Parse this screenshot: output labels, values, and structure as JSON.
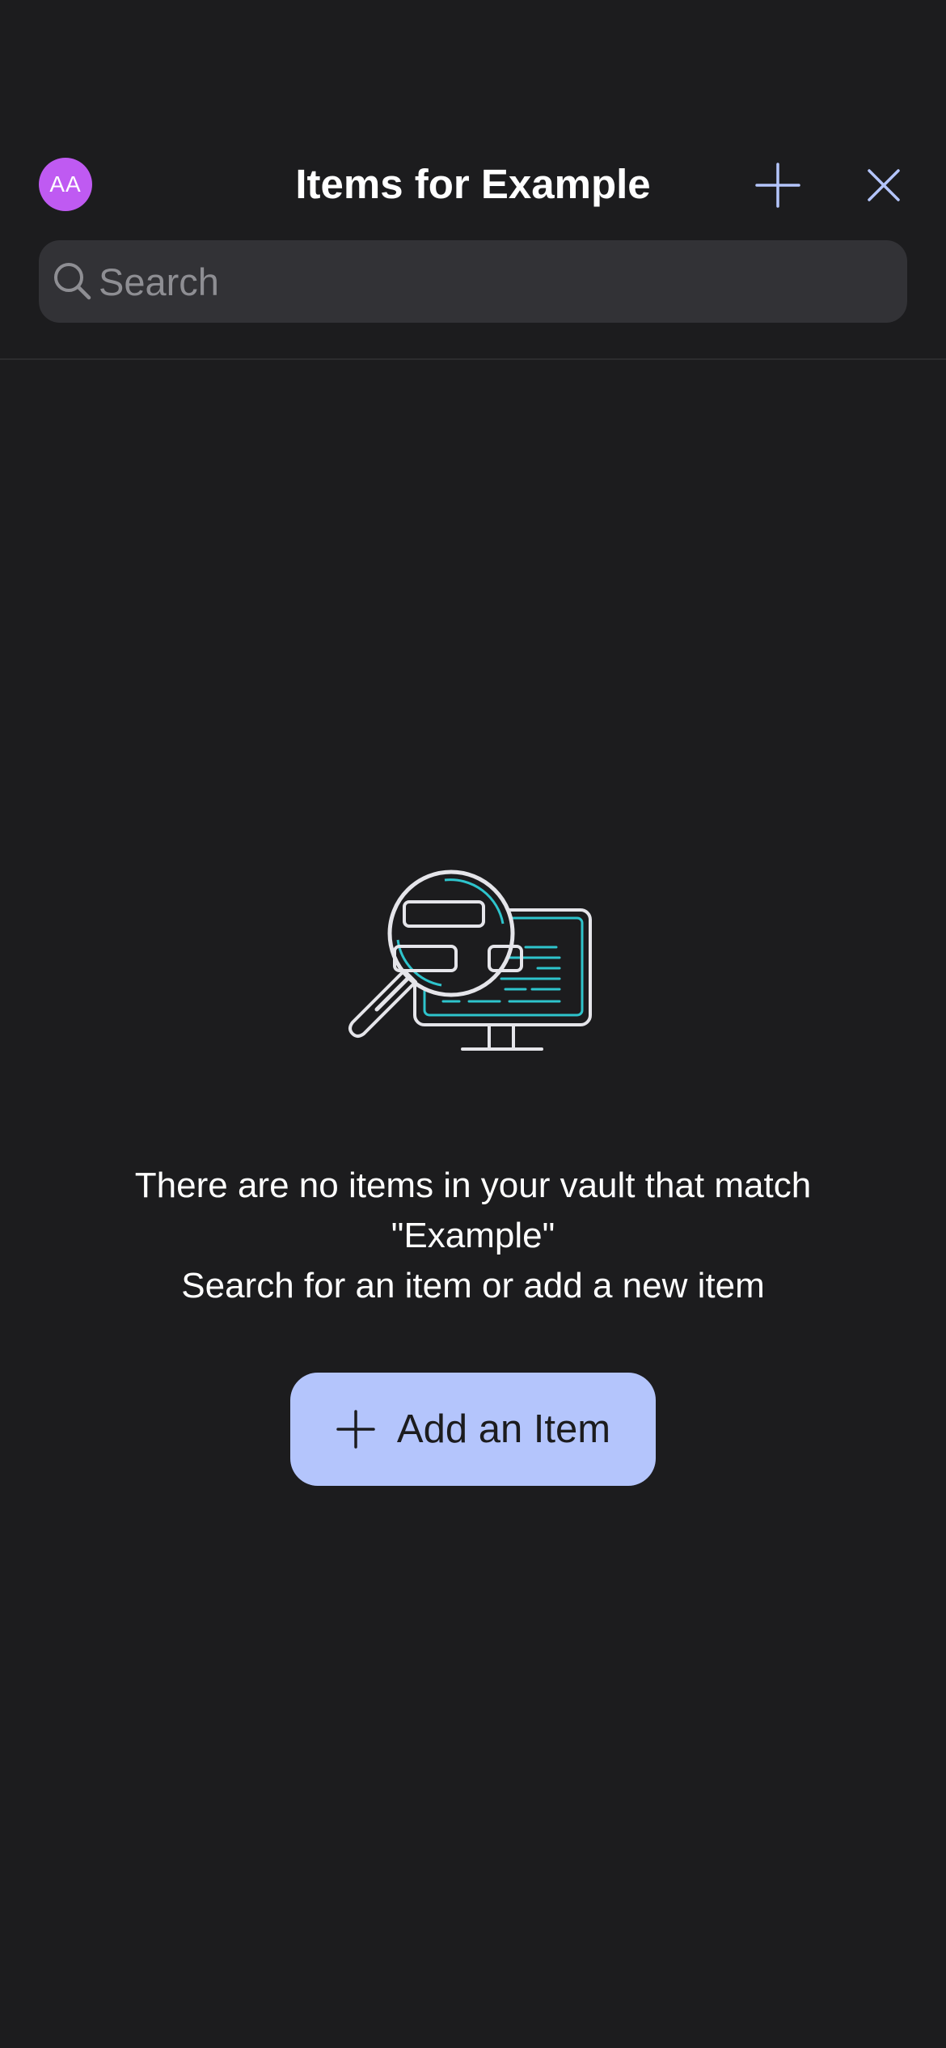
{
  "header": {
    "avatar_initials": "AA",
    "avatar_color": "#bf5af2",
    "title": "Items for Example",
    "add_icon": "plus-icon",
    "close_icon": "close-icon",
    "icon_color": "#b4c5fc"
  },
  "search": {
    "placeholder": "Search",
    "value": "",
    "icon": "search-icon"
  },
  "empty_state": {
    "illustration": "magnifier-over-monitor-illustration",
    "message_line1": "There are no items in your vault that match",
    "message_line2": "\"Example\"",
    "message_line3": "Search for an item or add a new item",
    "button_label": "Add an Item",
    "button_icon": "plus-icon",
    "button_color": "#b4c5fc"
  },
  "colors": {
    "background": "#1c1c1e",
    "search_field": "#323236",
    "illustration_accent": "#2ec4cc",
    "illustration_line": "#e5e5ea"
  }
}
